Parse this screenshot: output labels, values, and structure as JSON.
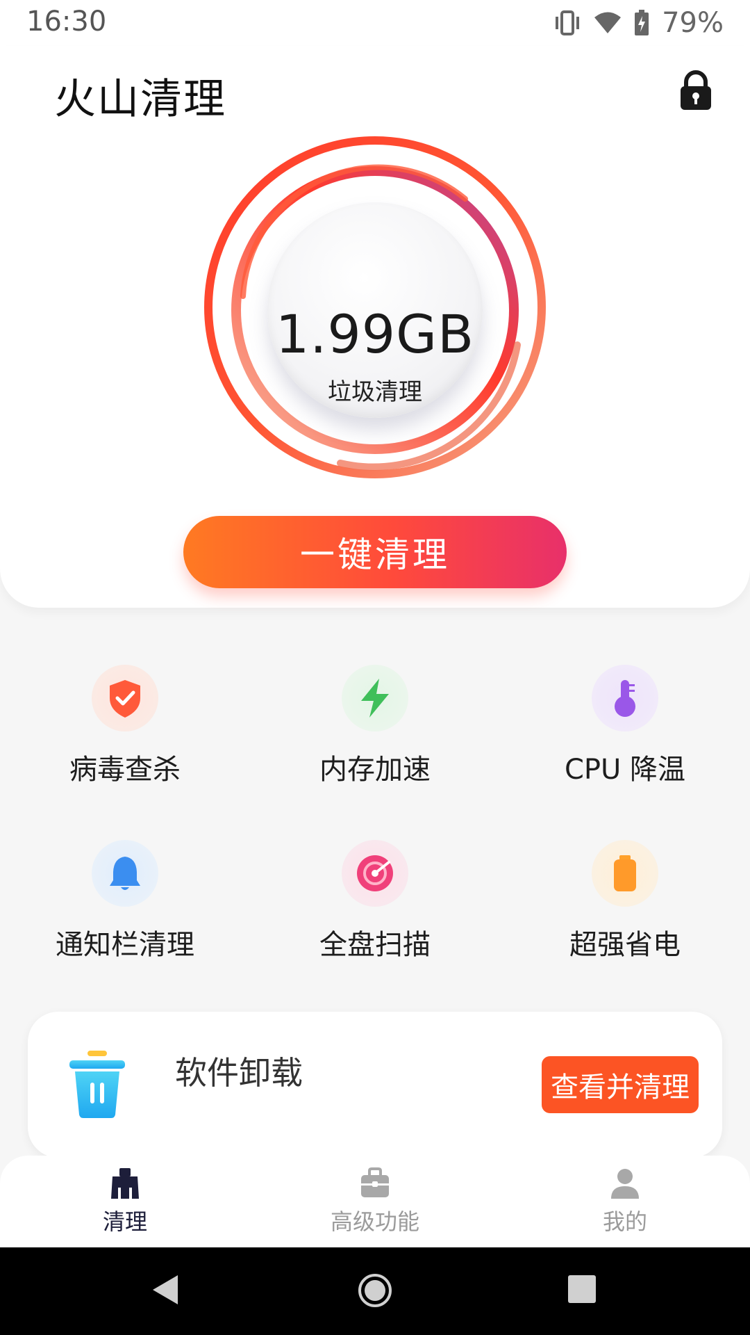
{
  "status_bar": {
    "time": "16:30",
    "battery": "79%",
    "icons": [
      "vibrate-icon",
      "wifi-icon",
      "battery-charging-icon"
    ]
  },
  "header": {
    "title": "火山清理",
    "lock_icon": "lock-icon"
  },
  "gauge": {
    "size": "1.99GB",
    "label": "垃圾清理",
    "colors": [
      "#ff3a2a",
      "#ff7a3d",
      "#b84a9a"
    ]
  },
  "clean_button": {
    "label": "一键清理"
  },
  "features": [
    {
      "label": "病毒查杀",
      "icon": "shield-check-icon",
      "color": "#ff5a3a"
    },
    {
      "label": "内存加速",
      "icon": "lightning-icon",
      "color": "#3fbf5a"
    },
    {
      "label": "CPU 降温",
      "icon": "thermometer-icon",
      "color": "#9a57e8"
    },
    {
      "label": "通知栏清理",
      "icon": "bell-icon",
      "color": "#3b8ef0"
    },
    {
      "label": "全盘扫描",
      "icon": "radar-icon",
      "color": "#f0407a"
    },
    {
      "label": "超强省电",
      "icon": "battery-icon",
      "color": "#ff9a2a"
    }
  ],
  "uninstall": {
    "title": "软件卸载",
    "button": "查看并清理",
    "icon": "trash-icon"
  },
  "bottom_nav": {
    "items": [
      {
        "label": "清理",
        "icon": "broom-icon",
        "active": true
      },
      {
        "label": "高级功能",
        "icon": "briefcase-icon",
        "active": false
      },
      {
        "label": "我的",
        "icon": "person-icon",
        "active": false
      }
    ]
  },
  "system_nav": [
    "back-icon",
    "home-icon",
    "recents-icon"
  ]
}
